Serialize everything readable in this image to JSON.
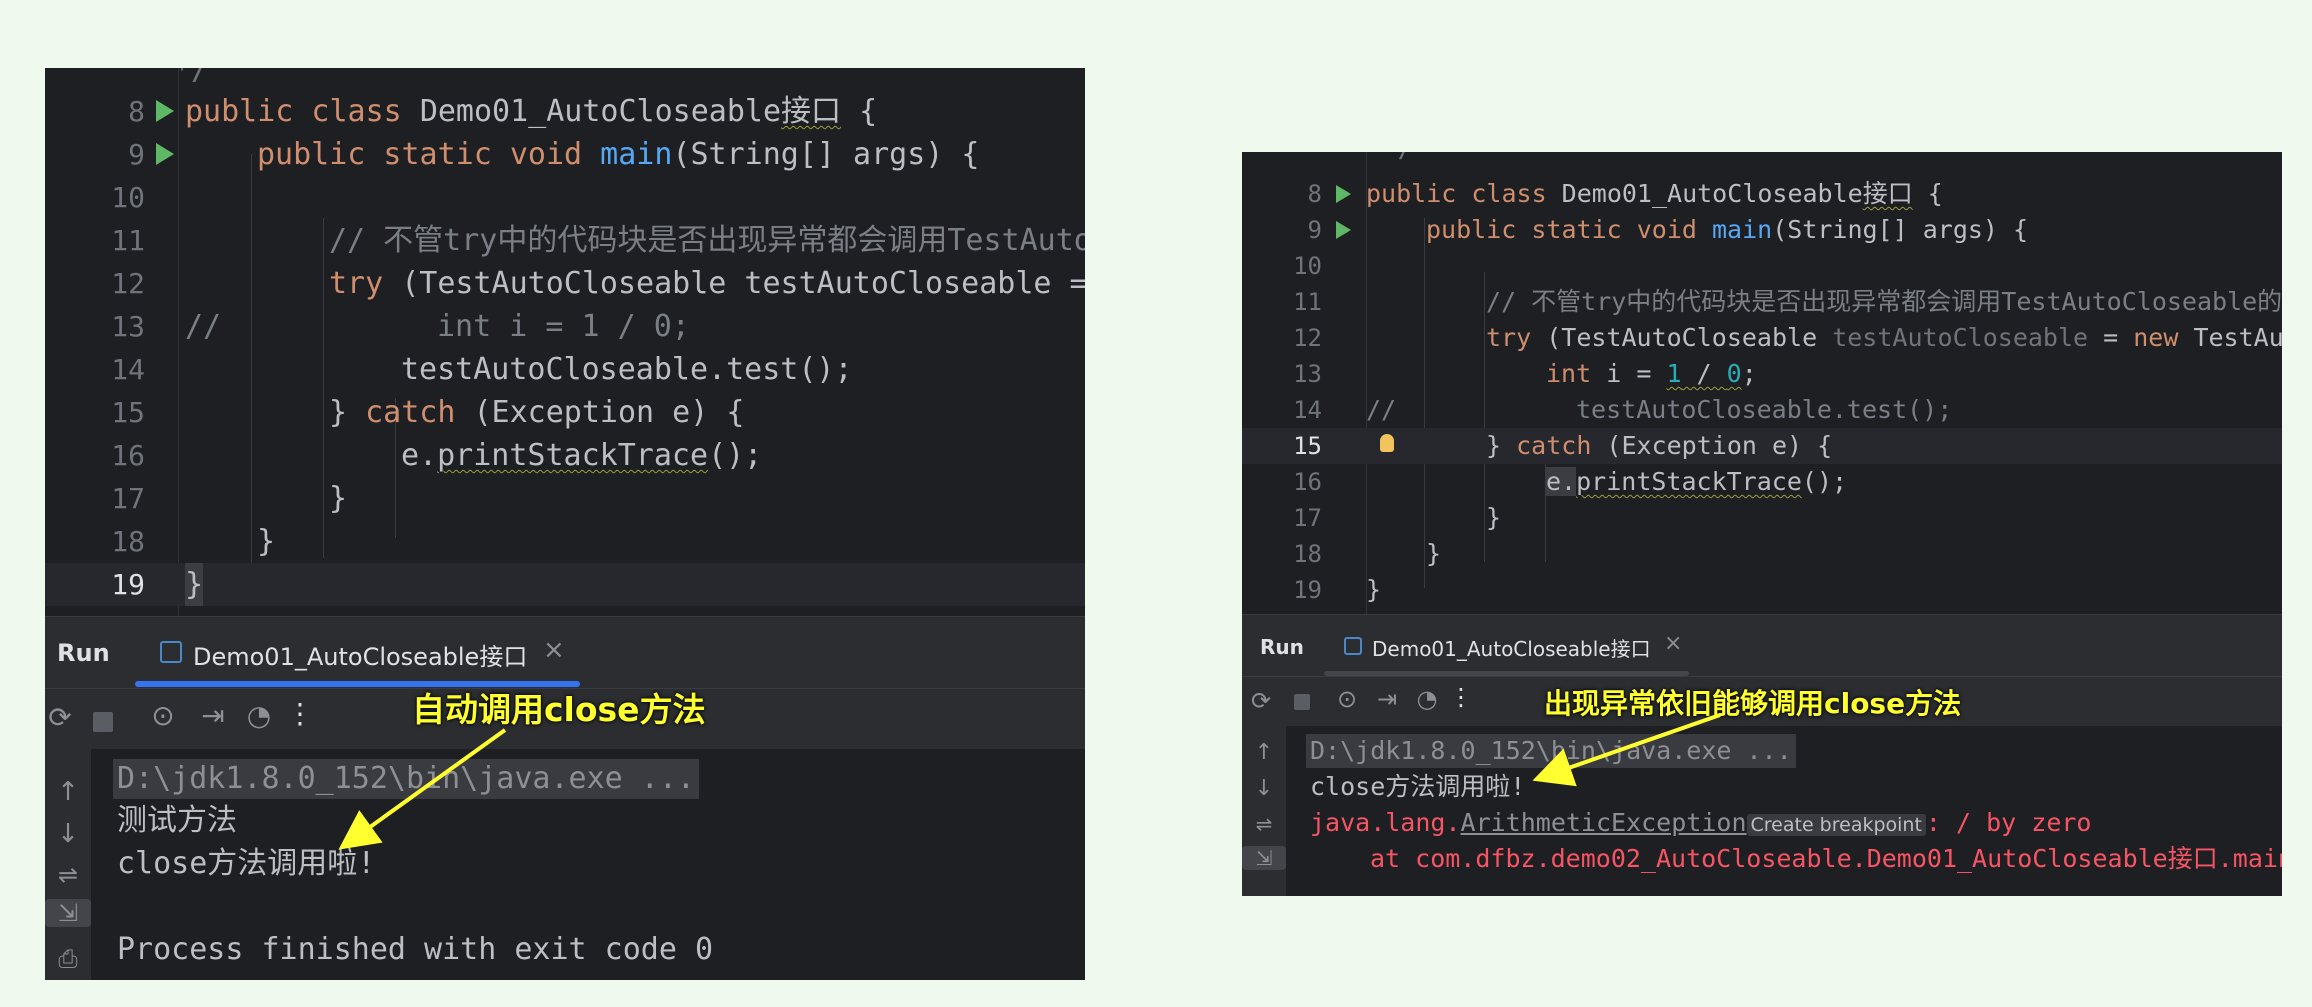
{
  "left": {
    "line_numbers": [
      "8",
      "9",
      "10",
      "11",
      "12",
      "13",
      "14",
      "15",
      "16",
      "17",
      "18",
      "19"
    ],
    "code": {
      "l8": {
        "kw": "public class ",
        "rest": "Demo01_AutoCloseable",
        "cn": "接口",
        "brace": " {"
      },
      "l9": {
        "kw": "public static void ",
        "fn": "main",
        "rest": "(String[] args) {"
      },
      "l11": "// 不管try中的代码块是否出现异常都会调用TestAuto",
      "l12": {
        "kw": "try ",
        "rest": "(TestAutoCloseable testAutoCloseable ="
      },
      "l13": {
        "c1": "//",
        "c2": "int i = 1 / 0;"
      },
      "l14": "testAutoCloseable.test();",
      "l15": {
        "a": "} ",
        "kw": "catch ",
        "rest": "(Exception e) {"
      },
      "l16": {
        "a": "e.",
        "b": "printStackTrace",
        "c": "();"
      },
      "l17": "}",
      "l18": "}",
      "l19": "}"
    },
    "run_label": "Run",
    "tab_label": "Demo01_AutoCloseable接口",
    "tab_close": "×",
    "console": {
      "cmd": "D:\\jdk1.8.0_152\\bin\\java.exe ...",
      "line2": "测试方法",
      "line3": "close方法调用啦!",
      "line5": "Process finished with exit code 0"
    },
    "annotation": "自动调用close方法"
  },
  "right": {
    "line_numbers": [
      "8",
      "9",
      "10",
      "11",
      "12",
      "13",
      "14",
      "15",
      "16",
      "17",
      "18",
      "19"
    ],
    "code": {
      "l8": {
        "kw": "public class ",
        "rest": "Demo01_AutoCloseable",
        "cn": "接口",
        "brace": " {"
      },
      "l9": {
        "kw": "public static void ",
        "fn": "main",
        "rest": "(String[] args) {"
      },
      "l11": "// 不管try中的代码块是否出现异常都会调用TestAutoCloseable的",
      "l12": {
        "kw": "try ",
        "a": "(TestAutoCloseable ",
        "dim": "testAutoCloseable",
        "b": " = ",
        "kw2": "new ",
        "c": "TestAut"
      },
      "l13": {
        "kw": "int ",
        "a": "i = ",
        "n1": "1",
        "b": " / ",
        "n2": "0",
        "c": ";"
      },
      "l14": {
        "c1": "//",
        "c2": "testAutoCloseable.test();"
      },
      "l15": {
        "a": "} ",
        "kw": "catch ",
        "rest": "(Exception e) {"
      },
      "l16": {
        "a": "e.",
        "b": "printStackTrace",
        "c": "();"
      },
      "l17": "}",
      "l18": "}",
      "l19": "}"
    },
    "run_label": "Run",
    "tab_label": "Demo01_AutoCloseable接口",
    "tab_close": "×",
    "console": {
      "cmd": "D:\\jdk1.8.0_152\\bin\\java.exe ...",
      "line2": "close方法调用啦!",
      "err_a": "java.lang.",
      "err_b": "ArithmeticException",
      "err_bp": "Create breakpoint",
      "err_c": ": / by zero",
      "err_at": "at com.dfbz.demo02_AutoCloseable.Demo01_AutoCloseable接口.main"
    },
    "annotation": "出现异常依旧能够调用close方法"
  },
  "colors": {
    "background": "#f0f9ee",
    "editor": "#1e1f22",
    "keyword": "#cf8e6d",
    "function": "#56a8f5",
    "comment": "#7a7e85",
    "error": "#f75464",
    "annotation": "#ffff30",
    "run_icon": "#5fb865"
  }
}
